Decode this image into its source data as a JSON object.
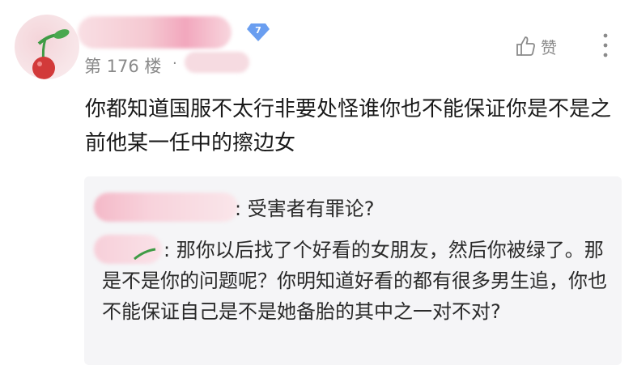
{
  "post": {
    "level": "7",
    "floor_label": "第 176 楼",
    "separator": "·",
    "like_label": "赞",
    "content": "你都知道国服不太行非要处怪谁你也不能保证你是不是之前他某一任中的擦边女"
  },
  "quote": {
    "reply1_sep": ":",
    "reply1_text": "受害者有罪论?",
    "reply2_sep": ":",
    "reply2_text": "那你以后找了个好看的女朋友，然后你被绿了。那是不是你的问题呢？你明知道好看的都有很多男生追，你也不能保证自己是不是她备胎的其中之一对不对?"
  },
  "icons": {
    "like": "thumbs-up-icon",
    "more": "more-vertical-icon",
    "level": "diamond-level-icon",
    "avatar": "cherry-avatar-icon"
  },
  "colors": {
    "badge": "#6a9ef0",
    "muted_text": "#8a8a8a",
    "quote_bg": "#f5f5f7",
    "cherry_red": "#d23a3a",
    "leaf_green": "#3f9b45"
  }
}
